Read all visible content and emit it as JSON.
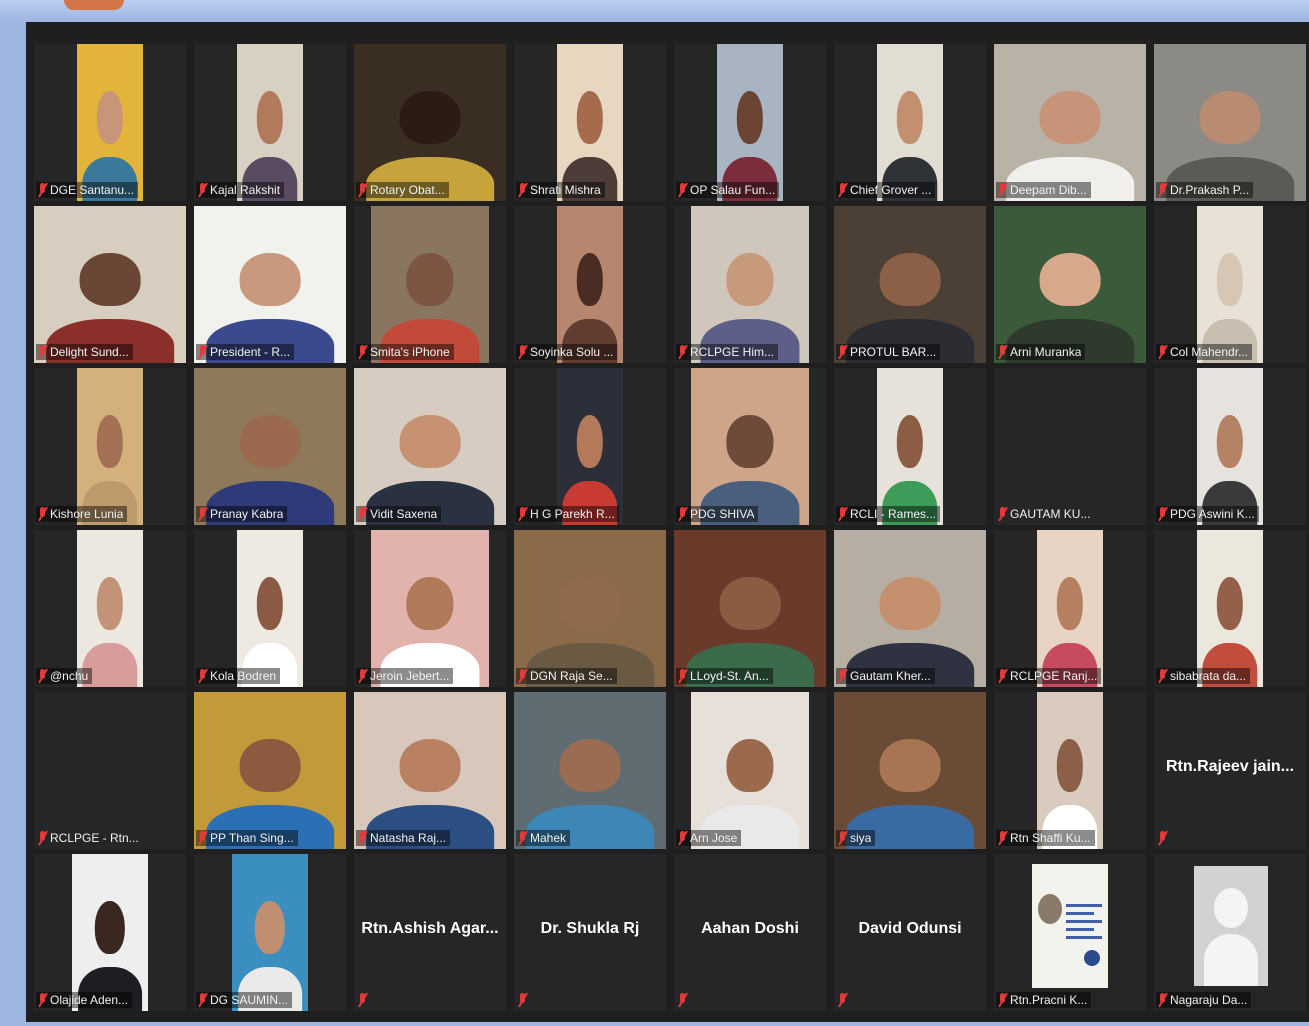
{
  "participants": [
    {
      "name": "DGE Santanu...",
      "video": true,
      "w": 66,
      "bg": "#e2b53a",
      "skin": "#c99578",
      "shirt": "#3c7a9c"
    },
    {
      "name": "Kajal Rakshit",
      "video": true,
      "w": 66,
      "bg": "#d8d0c2",
      "skin": "#b27a5d",
      "shirt": "#5a4b63"
    },
    {
      "name": "Rotary Obat...",
      "video": true,
      "w": 152,
      "bg": "#3a2e22",
      "skin": "#2a1c15",
      "shirt": "#c7a43b"
    },
    {
      "name": "Shrati Mishra",
      "video": true,
      "w": 66,
      "bg": "#e7d6c0",
      "skin": "#a56b4c",
      "shirt": "#4d3d38"
    },
    {
      "name": "OP Salau Fun...",
      "video": true,
      "w": 66,
      "bg": "#a9b4c2",
      "skin": "#6b4434",
      "shirt": "#7b2d3c"
    },
    {
      "name": "Chief Grover ...",
      "video": true,
      "w": 66,
      "bg": "#e2ddd2",
      "skin": "#c3906f",
      "shirt": "#2f3237"
    },
    {
      "name": "Deepam Dib...",
      "video": true,
      "w": 152,
      "bg": "#b9b2a6",
      "skin": "#c79479",
      "shirt": "#f0efec"
    },
    {
      "name": "Dr.Prakash P...",
      "video": true,
      "w": 152,
      "bg": "#8c8a84",
      "skin": "#b98b70",
      "shirt": "#5c5a55"
    },
    {
      "name": "Delight Sund...",
      "video": true,
      "w": 152,
      "bg": "#d7cec0",
      "skin": "#6a4636",
      "shirt": "#8a2f2a"
    },
    {
      "name": "President - R...",
      "video": true,
      "w": 152,
      "bg": "#f1f1ee",
      "skin": "#c8997c",
      "shirt": "#3b4a8f"
    },
    {
      "name": "Smita's iPhone",
      "video": true,
      "w": 118,
      "bg": "#8a7560",
      "skin": "#7c5543",
      "shirt": "#c24a3a"
    },
    {
      "name": "Soyinka Solu ...",
      "video": true,
      "w": 66,
      "bg": "#b6866f",
      "skin": "#4a2d22",
      "shirt": "#613c30"
    },
    {
      "name": "RCLPGE Him...",
      "video": true,
      "w": 118,
      "bg": "#cfc7bb",
      "skin": "#c89a7c",
      "shirt": "#5d5f8a"
    },
    {
      "name": "PROTUL BAR...",
      "video": true,
      "w": 152,
      "bg": "#4c4036",
      "skin": "#8b6046",
      "shirt": "#2c2c33"
    },
    {
      "name": "Arni Muranka",
      "video": true,
      "w": 152,
      "bg": "#3b5a3a",
      "skin": "#d7a98a",
      "shirt": "#2d3a2c"
    },
    {
      "name": "Col Mahendr...",
      "video": true,
      "w": 66,
      "bg": "#e8e1d6",
      "skin": "#d8c6b4",
      "shirt": "#c9bfb0"
    },
    {
      "name": "Kishore Lunia",
      "video": true,
      "w": 66,
      "bg": "#d4b17c",
      "skin": "#a47155",
      "shirt": "#bd9a6b"
    },
    {
      "name": "Pranay Kabra",
      "video": true,
      "w": 152,
      "bg": "#8e7a5b",
      "skin": "#9b6a4e",
      "shirt": "#2f3a78"
    },
    {
      "name": "Vidit Saxena",
      "video": true,
      "w": 152,
      "bg": "#d7ccc2",
      "skin": "#c69272",
      "shirt": "#2a3242"
    },
    {
      "name": "H G Parekh R...",
      "video": true,
      "w": 66,
      "bg": "#2c2f3a",
      "skin": "#b4795a",
      "shirt": "#c83a32"
    },
    {
      "name": "PDG SHIVA",
      "video": true,
      "w": 118,
      "bg": "#cfa58a",
      "skin": "#6d4a3a",
      "shirt": "#4a5f7d"
    },
    {
      "name": "RCLI - Rames...",
      "video": true,
      "w": 66,
      "bg": "#e6e2da",
      "skin": "#8c5d44",
      "shirt": "#3d9c58"
    },
    {
      "name": "GAUTAM KU...",
      "video": false
    },
    {
      "name": "PDG Aswini K...",
      "video": true,
      "w": 66,
      "bg": "#e6e2dd",
      "skin": "#b48265",
      "shirt": "#3a3a3a"
    },
    {
      "name": "@nchu",
      "video": true,
      "w": 66,
      "bg": "#ece8e0",
      "skin": "#c29377",
      "shirt": "#d89c9a"
    },
    {
      "name": "Kola Bodren",
      "video": true,
      "w": 66,
      "bg": "#eeeae2",
      "skin": "#8a5a44",
      "shirt": "#ffffff"
    },
    {
      "name": "Jeroin Jebert...",
      "video": true,
      "w": 118,
      "bg": "#e2b3ac",
      "skin": "#b07a5a",
      "shirt": "#ffffff"
    },
    {
      "name": "DGN Raja Se...",
      "video": true,
      "w": 152,
      "bg": "#8b6a4a",
      "skin": "#8f6a4d",
      "shirt": "#6a5a44"
    },
    {
      "name": "LLoyd-St. An...",
      "video": true,
      "w": 152,
      "bg": "#6b3a2a",
      "skin": "#8a5d42",
      "shirt": "#3b6b4b"
    },
    {
      "name": "Gautam Kher...",
      "video": true,
      "w": 152,
      "bg": "#b6aea2",
      "skin": "#c5906e",
      "shirt": "#2f3240"
    },
    {
      "name": "RCLPGE Ranj...",
      "video": true,
      "w": 66,
      "bg": "#e7d4c4",
      "skin": "#b57f61",
      "shirt": "#c64b5e"
    },
    {
      "name": "sibabrata da...",
      "video": true,
      "w": 66,
      "bg": "#ece7dd",
      "skin": "#94604a",
      "shirt": "#c14e3c"
    },
    {
      "name": "RCLPGE - Rtn...",
      "video": false
    },
    {
      "name": "PP Than Sing...",
      "video": true,
      "w": 152,
      "bg": "#c39a3a",
      "skin": "#8d5a3f",
      "shirt": "#2b6fb4"
    },
    {
      "name": "Natasha Raj...",
      "video": true,
      "w": 152,
      "bg": "#d8c8bc",
      "skin": "#b98161",
      "shirt": "#2b4f83"
    },
    {
      "name": "Mahek",
      "video": true,
      "w": 152,
      "bg": "#5f6d73",
      "skin": "#9a6c52",
      "shirt": "#3c86b8"
    },
    {
      "name": "Arn Jose",
      "video": true,
      "w": 118,
      "bg": "#e6e0d8",
      "skin": "#9b6a4c",
      "shirt": "#e9e9ea"
    },
    {
      "name": "siya",
      "video": true,
      "w": 152,
      "bg": "#6a4c36",
      "skin": "#a77454",
      "shirt": "#3a6aa2"
    },
    {
      "name": "Rtn Shaffi Ku...",
      "video": true,
      "w": 66,
      "bg": "#d9cbbd",
      "skin": "#8b5f48",
      "shirt": "#ffffff"
    },
    {
      "name": "",
      "display_name": "Rtn.Rajeev  jain...",
      "video": false
    },
    {
      "name": "Olajide Aden...",
      "video": true,
      "w": 76,
      "bg": "#eeeeee",
      "skin": "#3a2820",
      "shirt": "#1d1d22"
    },
    {
      "name": "DG SAUMIN...",
      "video": true,
      "w": 76,
      "bg": "#3a8fc0",
      "skin": "#c08f72",
      "shirt": "#eaeaea"
    },
    {
      "name": "",
      "display_name": "Rtn.Ashish  Agar...",
      "video": false
    },
    {
      "name": "",
      "display_name": "Dr. Shukla Rj",
      "video": false
    },
    {
      "name": "",
      "display_name": "Aahan Doshi",
      "video": false
    },
    {
      "name": "",
      "display_name": "David Odunsi",
      "video": false
    },
    {
      "name": "Rtn.Pracni K...",
      "video": false,
      "flyer": true
    },
    {
      "name": "Nagaraju Da...",
      "video": false,
      "avatar": true
    }
  ],
  "colors": {
    "background": "#1f1f1f",
    "tile": "#262626",
    "mute": "#e23b3b",
    "frame": "#9fb6e3"
  },
  "icons": {
    "mute": "muted-microphone-icon"
  }
}
